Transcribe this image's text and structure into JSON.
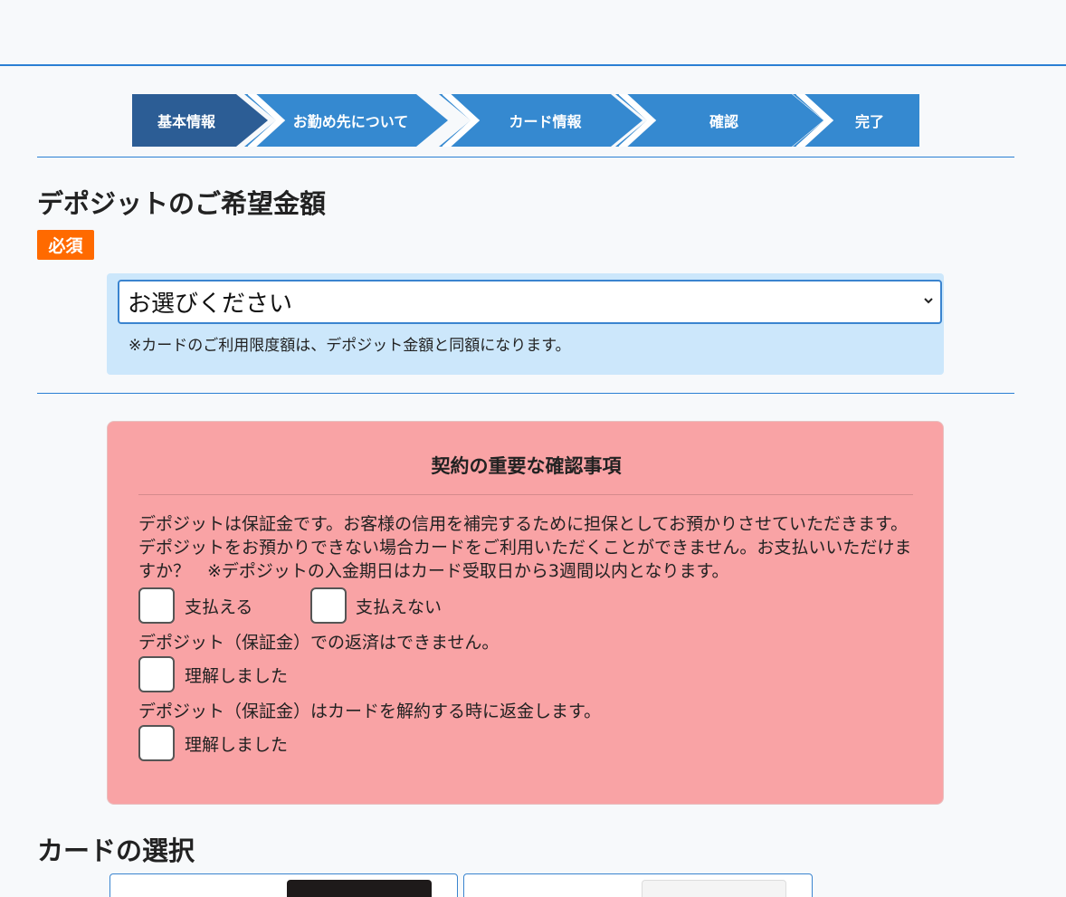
{
  "steps": [
    {
      "label": "基本情報",
      "active": true
    },
    {
      "label": "お勤め先について",
      "active": false
    },
    {
      "label": "カード情報",
      "active": false
    },
    {
      "label": "確認",
      "active": false
    },
    {
      "label": "完了",
      "active": false
    }
  ],
  "colors": {
    "step_active": "#2c5d95",
    "step_inactive": "#3589d0",
    "required": "#ff6a00",
    "accent": "#2a7fd4",
    "confirm_bg": "#f9a3a5",
    "select_panel": "#cce7fb"
  },
  "deposit": {
    "title": "デポジットのご希望金額",
    "required_badge": "必須",
    "select_value": "お選びください",
    "note": "※カードのご利用限度額は、デポジット金額と同額になります。"
  },
  "confirm": {
    "title": "契約の重要な確認事項",
    "paragraph": "デポジットは保証金です。お客様の信用を補完するために担保としてお預かりさせていただきます。デポジットをお預かりできない場合カードをご利用いただくことができません。お支払いいただけますか？　※デポジットの入金期日はカード受取日から3週間以内となります。",
    "option_pay": "支払える",
    "option_not_pay": "支払えない",
    "statement1": "デポジット（保証金）での返済はできません。",
    "understood1": "理解しました",
    "statement2": "デポジット（保証金）はカードを解約する時に返金します。",
    "understood2": "理解しました"
  },
  "card_section": {
    "title": "カードの選択"
  }
}
